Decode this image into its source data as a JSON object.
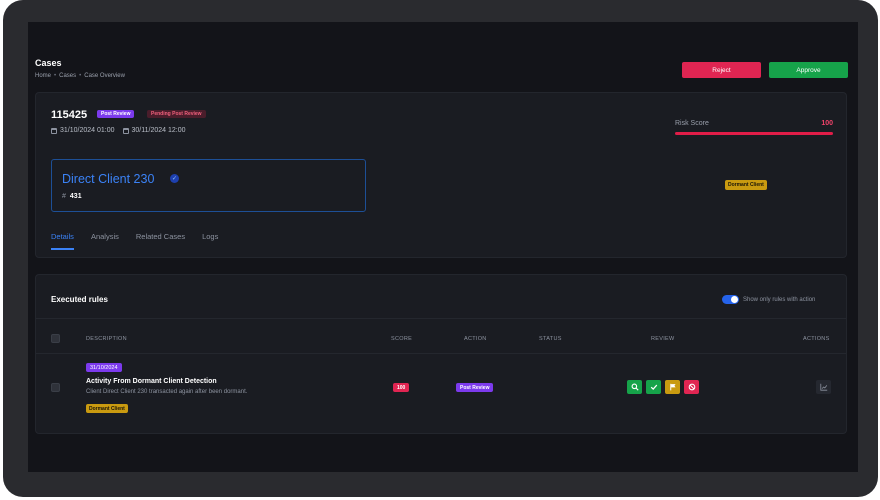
{
  "header": {
    "title": "Cases",
    "breadcrumb": [
      "Home",
      "Cases",
      "Case Overview"
    ],
    "separator": "•"
  },
  "buttons": {
    "reject": "Reject",
    "approve": "Approve"
  },
  "case": {
    "id": "115425",
    "status_badge": "Post Review",
    "pending_badge": "Pending Post Review",
    "start_date": "31/10/2024 01:00",
    "end_date": "30/11/2024 12:00",
    "risk_label": "Risk Score",
    "risk_value": "100",
    "risk_fraction": 1.0,
    "client_name": "Direct Client 230",
    "client_hash": "#",
    "client_number": "431",
    "client_tag": "Dormant Client"
  },
  "tabs": [
    {
      "label": "Details",
      "active": true
    },
    {
      "label": "Analysis",
      "active": false
    },
    {
      "label": "Related Cases",
      "active": false
    },
    {
      "label": "Logs",
      "active": false
    }
  ],
  "rules": {
    "title": "Executed rules",
    "toggle_label": "Show only rules with action",
    "toggle_on": true,
    "columns": {
      "description": "DESCRIPTION",
      "score": "SCORE",
      "action": "ACTION",
      "status": "STATUS",
      "review": "REVIEW",
      "actions": "ACTIONS"
    },
    "rows": [
      {
        "date": "31/10/2024",
        "title": "Activity From Dormant Client Detection",
        "description": "Client Direct Client 230 transacted again after been dormant.",
        "tag": "Dormant Client",
        "score": "100",
        "action": "Post Review",
        "status": ""
      }
    ]
  },
  "colors": {
    "accent": "#3b82f6",
    "danger": "#e02552",
    "success": "#16a34a",
    "warning": "#c99a10",
    "purple": "#7c3aed"
  },
  "icons": {
    "review": [
      "search-icon",
      "check-icon",
      "flag-icon",
      "block-icon"
    ],
    "actions": "chart-icon"
  }
}
